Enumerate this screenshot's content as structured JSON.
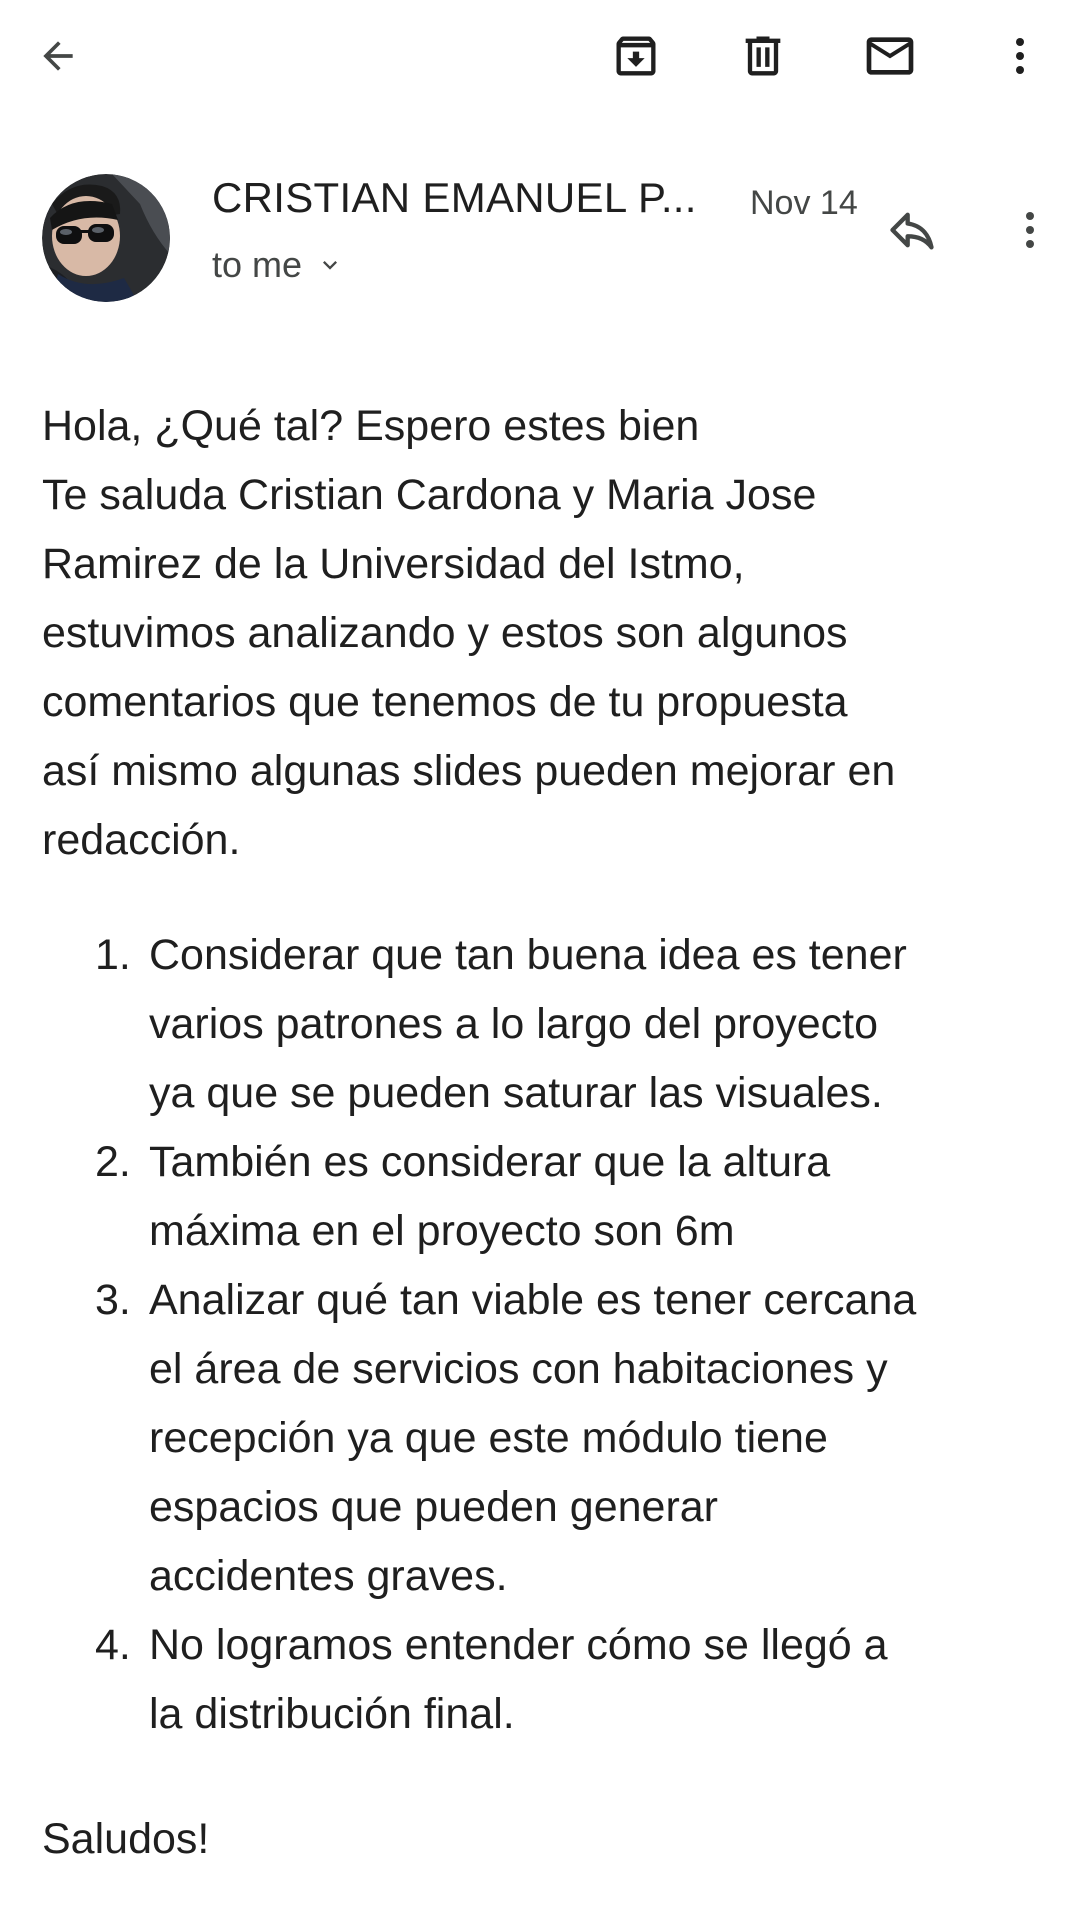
{
  "toolbar": {
    "back_icon": "arrow-back-icon",
    "archive_icon": "archive-icon",
    "delete_icon": "trash-icon",
    "mark_unread_icon": "mail-icon",
    "more_icon": "more-vert-icon"
  },
  "message": {
    "sender": "CRISTIAN EMANUEL P...",
    "date": "Nov 14",
    "recipient": "to me",
    "body_intro": [
      "Hola, ¿Qué tal? Espero estes bien",
      "Te saluda Cristian Cardona y Maria Jose",
      "Ramirez de la Universidad del Istmo,",
      "estuvimos analizando y estos son algunos",
      "comentarios que tenemos de tu propuesta",
      "así mismo algunas slides pueden mejorar en",
      "redacción."
    ],
    "comments": [
      {
        "num": "1.",
        "lines": [
          "Considerar que tan buena idea es tener",
          "varios patrones a lo largo del proyecto",
          "ya que se pueden saturar las visuales."
        ]
      },
      {
        "num": "2.",
        "lines": [
          "También es considerar que la altura",
          "máxima en el proyecto son 6m"
        ]
      },
      {
        "num": "3.",
        "lines": [
          "Analizar qué tan viable es tener cercana",
          "el área de servicios con habitaciones y",
          "recepción ya que este módulo tiene",
          "espacios que pueden generar",
          "accidentes graves."
        ]
      },
      {
        "num": "4.",
        "lines": [
          "No logramos entender cómo se llegó a",
          "la distribución final."
        ]
      }
    ],
    "closing": "Saludos!"
  },
  "colors": {
    "text": "#1f1f1f",
    "secondary_text": "#444746"
  }
}
